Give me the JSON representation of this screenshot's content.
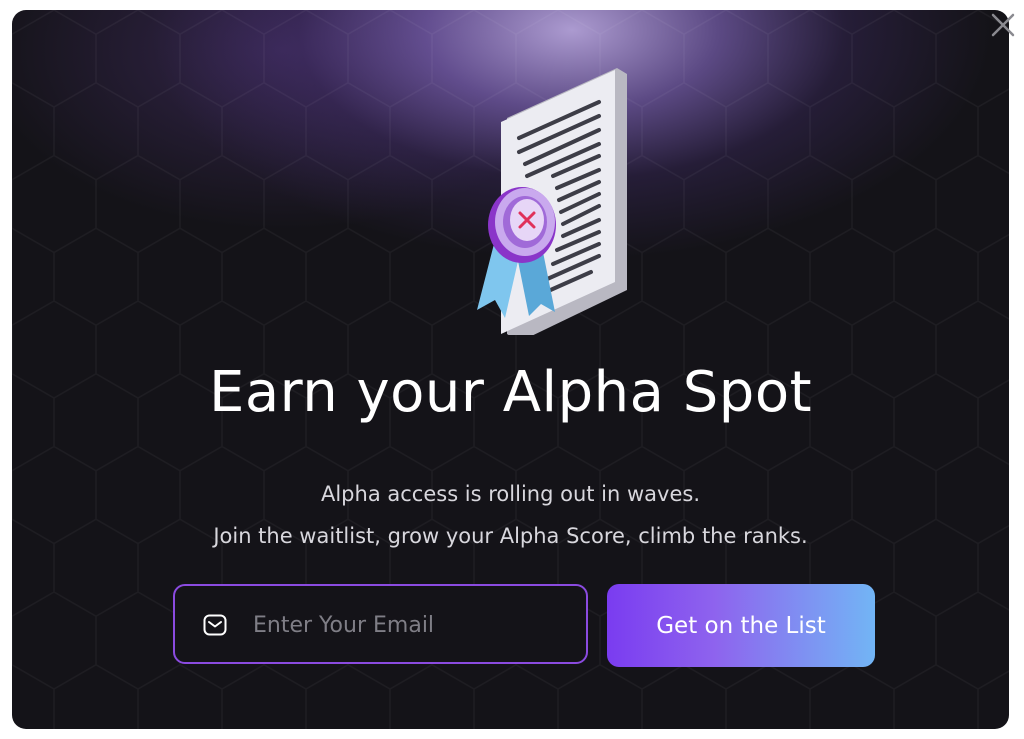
{
  "modal": {
    "title": "Earn your Alpha Spot",
    "subtitle_line1": "Alpha access is rolling out in waves.",
    "subtitle_line2": "Join the waitlist, grow your Alpha Score, climb the ranks.",
    "email": {
      "value": "",
      "placeholder": "Enter Your Email",
      "icon": "mail-icon"
    },
    "cta_label": "Get on the List",
    "close_icon": "close-icon",
    "illustration": "certificate-document-with-badge"
  },
  "colors": {
    "background": "#141318",
    "accent_purple": "#8b4be0",
    "cta_gradient_start": "#7a3cf0",
    "cta_gradient_end": "#72b5f5",
    "text": "#ffffff"
  }
}
